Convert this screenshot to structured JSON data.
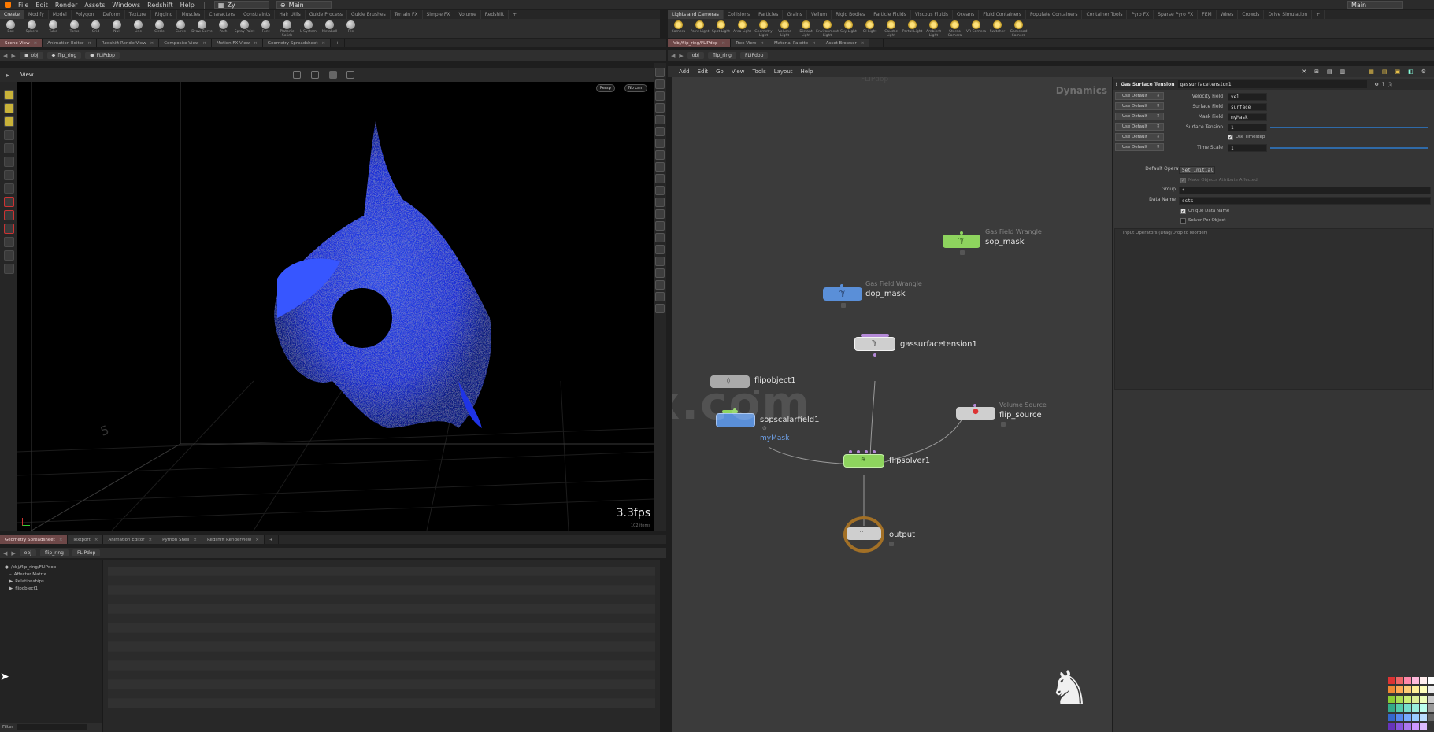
{
  "menubar": {
    "items": [
      "File",
      "Edit",
      "Render",
      "Assets",
      "Windows",
      "Redshift",
      "Help"
    ],
    "desktop_value": "Zy",
    "build_value": "Main",
    "right_value": "Main"
  },
  "shelf_left": {
    "tabs": [
      "Create",
      "Modify",
      "Model",
      "Polygon",
      "Deform",
      "Texture",
      "Rigging",
      "Muscles",
      "Characters",
      "Constraints",
      "Hair Utils",
      "Guide Process",
      "Guide Brushes",
      "Terrain FX",
      "Simple FX",
      "Volume",
      "Redshift"
    ],
    "tools": [
      "Box",
      "Sphere",
      "Tube",
      "Torus",
      "Grid",
      "Null",
      "Line",
      "Circle",
      "Curve",
      "Draw Curve",
      "Path",
      "Spray Paint",
      "Font",
      "Platonic Solids",
      "L-System",
      "Metaball",
      "File"
    ]
  },
  "shelf_right": {
    "tabs": [
      "Lights and Cameras",
      "Collisions",
      "Particles",
      "Grains",
      "Vellum",
      "Rigid Bodies",
      "Particle Fluids",
      "Viscous Fluids",
      "Oceans",
      "Fluid Containers",
      "Populate Containers",
      "Container Tools",
      "Pyro FX",
      "Sparse Pyro FX",
      "FEM",
      "Wires",
      "Crowds",
      "Drive Simulation"
    ],
    "tools": [
      "Camera",
      "Point Light",
      "Spot Light",
      "Area Light",
      "Geometry Light",
      "Volume Light",
      "Distant Light",
      "Environment Light",
      "Sky Light",
      "GI Light",
      "Caustic Light",
      "Portal Light",
      "Ambient Light",
      "Stereo Camera",
      "VR Camera",
      "Switcher",
      "Gamepad Camera"
    ]
  },
  "left_pane_tabs": [
    "Scene View",
    "Animation Editor",
    "Redshift RenderView",
    "Composite View",
    "Motion FX View",
    "Geometry Spreadsheet"
  ],
  "right_pane_tabs": [
    "/obj/flip_ring/FLIPdop",
    "Tree View",
    "Material Palette",
    "Asset Browser"
  ],
  "bottom_pane_tabs": [
    "Geometry Spreadsheet",
    "Textport",
    "Animation Editor",
    "Python Shell",
    "Redshift Renderview"
  ],
  "path": {
    "obj": "obj",
    "object": "flip_ring",
    "dop": "FLIPdop"
  },
  "viewport": {
    "label": "View",
    "persp": "Persp",
    "cam": "No cam",
    "fps": "3.3fps",
    "fps_sub": "102 items"
  },
  "tree": {
    "items": [
      "/obj/flip_ring/FLIPdop",
      "Affector Matrix",
      "Relationships",
      "flipobject1"
    ],
    "filter_label": "Filter"
  },
  "network_menu": [
    "Add",
    "Edit",
    "Go",
    "View",
    "Tools",
    "Layout",
    "Help"
  ],
  "network": {
    "context_label": "Dynamics",
    "watermark": "iiivfx.com",
    "nodes": {
      "sop_mask": {
        "name": "sop_mask",
        "type": "Gas Field Wrangle"
      },
      "dop_mask": {
        "name": "dop_mask",
        "type": "Gas Field Wrangle"
      },
      "gassurfacetension1": {
        "name": "gassurfacetension1"
      },
      "flipobject1": {
        "name": "flipobject1"
      },
      "sopscalarfield1": {
        "name": "sopscalarfield1",
        "comment": "myMask"
      },
      "flip_source": {
        "name": "flip_source",
        "type": "Volume Source"
      },
      "flipsolver1": {
        "name": "flipsolver1"
      },
      "output": {
        "name": "output"
      }
    }
  },
  "params": {
    "node_type": "Gas Surface Tension",
    "node_name": "gassurfacetension1",
    "rows": [
      {
        "dd": "Use Default",
        "label": "Velocity Field",
        "value": "vel"
      },
      {
        "dd": "Use Default",
        "label": "Surface Field",
        "value": "surface"
      },
      {
        "dd": "Use Default",
        "label": "Mask Field",
        "value": "myMask"
      },
      {
        "dd": "Use Default",
        "label": "Surface Tension",
        "value": "1"
      },
      {
        "dd": "Use Default",
        "label": "Use Timestep",
        "value": ""
      },
      {
        "dd": "Use Default",
        "label": "Time Scale",
        "value": "1"
      }
    ],
    "default_operation_label": "Default Operation",
    "default_operation_value": "Set Initial",
    "make_objects_label": "Make Objects Attribute Affected",
    "group_label": "Group",
    "group_value": "*",
    "data_name_label": "Data Name",
    "data_name_value": "ssts",
    "unique_label": "Unique Data Name",
    "solver_label": "Solver Per Object",
    "input_label": "Input Operators (Drag/Drop to reorder)"
  },
  "colors": {
    "accent_tab": "#6e4848",
    "points": "#1f3cff",
    "node_green": "#8ed45e",
    "node_blue": "#5a8fd8",
    "node_grey": "#cfcfcf"
  }
}
